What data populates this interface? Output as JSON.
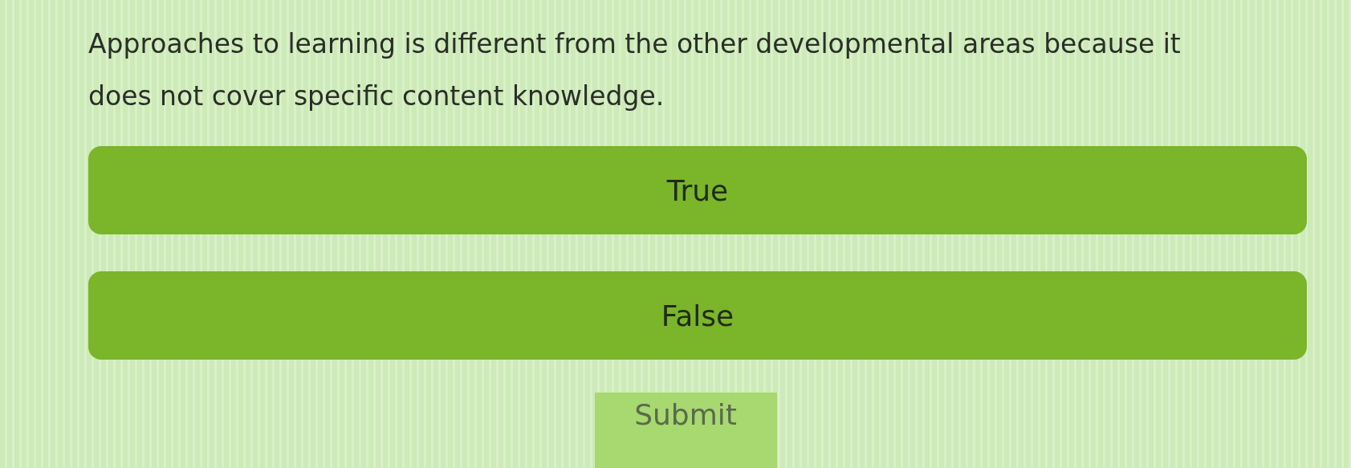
{
  "question": "Approaches to learning is different from the other developmental areas because it does not cover specific content knowledge.",
  "options": [
    {
      "label": "True",
      "selected": false
    },
    {
      "label": "False",
      "selected": false
    }
  ],
  "submit": {
    "label": "Submit",
    "disabled": true
  }
}
